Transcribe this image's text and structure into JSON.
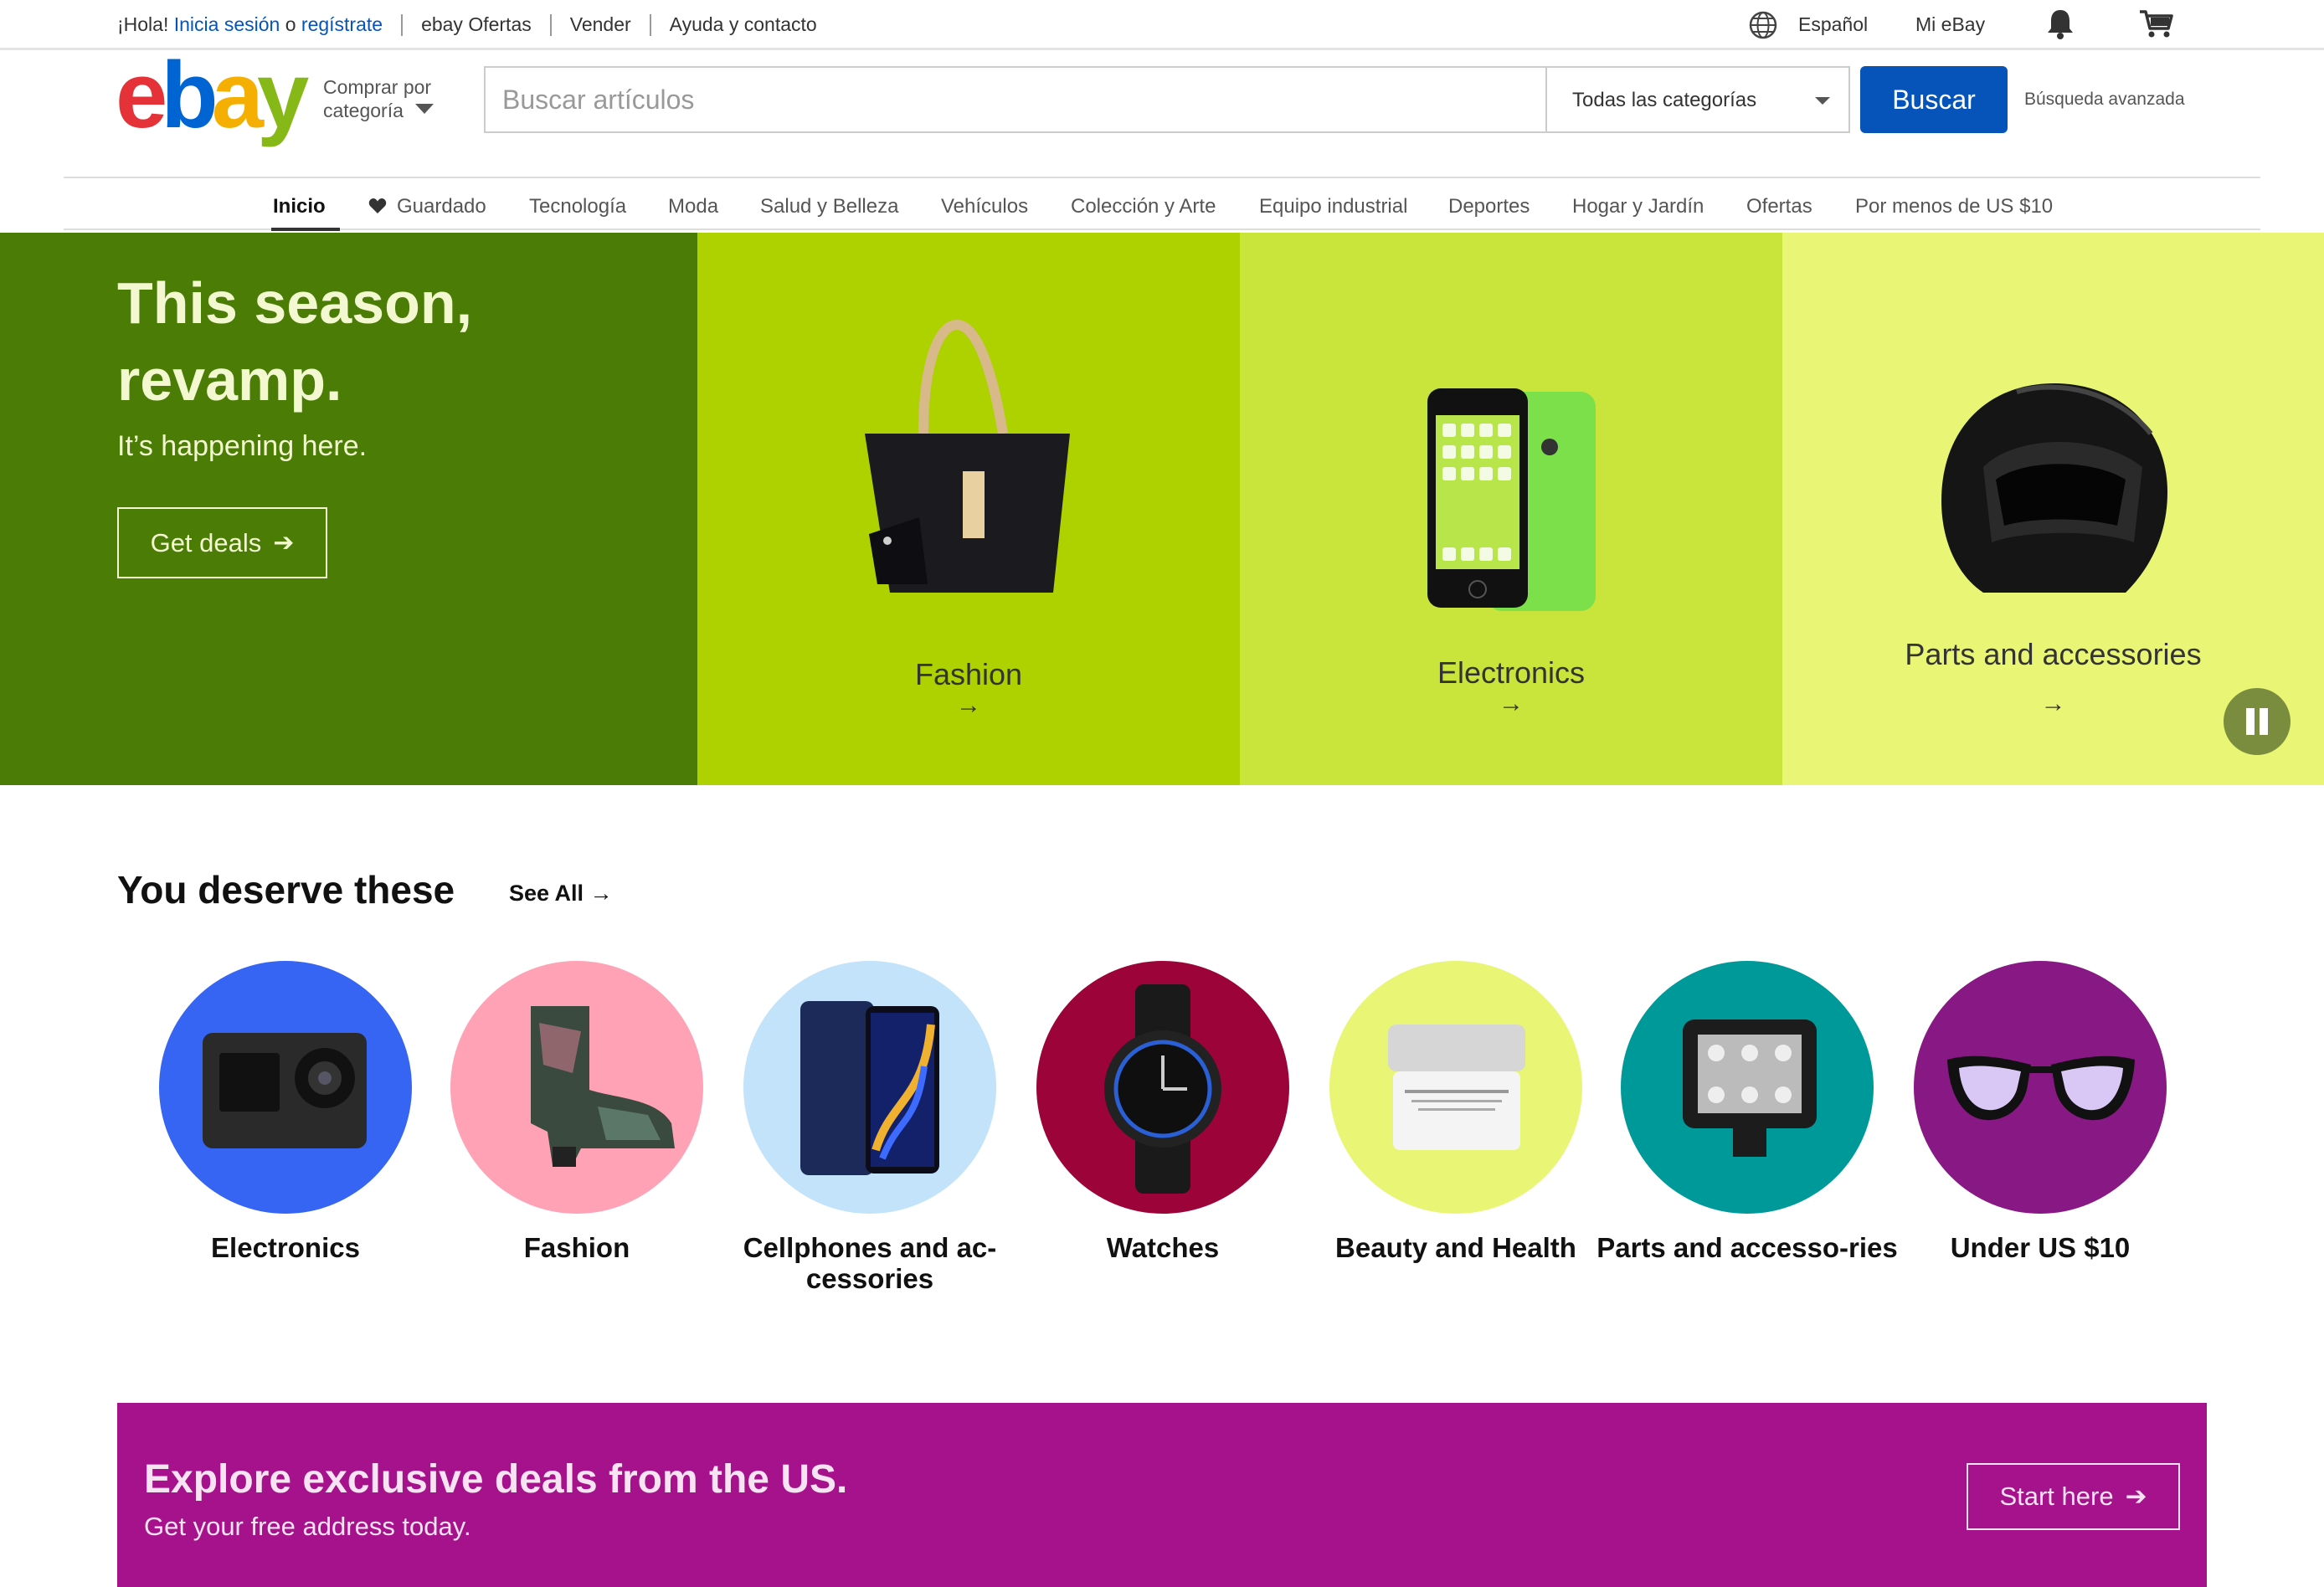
{
  "topbar": {
    "greeting": "¡Hola!",
    "signin": "Inicia sesión",
    "or": "o",
    "register": "regístrate",
    "deals": "ebay Ofertas",
    "sell": "Vender",
    "help": "Ayuda y contacto",
    "language": "Español",
    "my_ebay": "Mi eBay"
  },
  "header": {
    "logo": [
      "e",
      "b",
      "a",
      "y"
    ],
    "shop_by_category_line1": "Comprar por",
    "shop_by_category_line2": "categoría",
    "search_placeholder": "Buscar artículos",
    "category_selected": "Todas las categorías",
    "search_button": "Buscar",
    "advanced": "Búsqueda avanzada"
  },
  "nav": {
    "items": [
      "Inicio",
      "Guardado",
      "Tecnología",
      "Moda",
      "Salud y Belleza",
      "Vehículos",
      "Colección y Arte",
      "Equipo industrial",
      "Deportes",
      "Hogar y Jardín",
      "Ofertas",
      "Por menos de US $10"
    ]
  },
  "hero": {
    "title": "This season, revamp.",
    "subtitle": "It’s happening here.",
    "cta": "Get deals",
    "cta_arrow": "➔",
    "panels": [
      {
        "label": "Fashion",
        "arrow": "→"
      },
      {
        "label": "Electronics",
        "arrow": "→"
      },
      {
        "label": "Parts and accessories",
        "arrow": "→"
      }
    ]
  },
  "deserve": {
    "title": "You deserve these",
    "see_all": "See All",
    "see_all_arrow": "→",
    "items": [
      {
        "label": "Electronics",
        "color": "#3665f3"
      },
      {
        "label": "Fashion",
        "color": "#ffa2b6"
      },
      {
        "label": "Cellphones and ac-cessories",
        "color": "#c2e3fa"
      },
      {
        "label": "Watches",
        "color": "#9b0339"
      },
      {
        "label": "Beauty and Health",
        "color": "#e8f575"
      },
      {
        "label": "Parts and accesso-ries",
        "color": "#00999a"
      },
      {
        "label": "Under US $10",
        "color": "#871884"
      }
    ]
  },
  "promo": {
    "title": "Explore exclusive deals from the US.",
    "subtitle": "Get your free address today.",
    "cta": "Start here",
    "cta_arrow": "➔"
  }
}
